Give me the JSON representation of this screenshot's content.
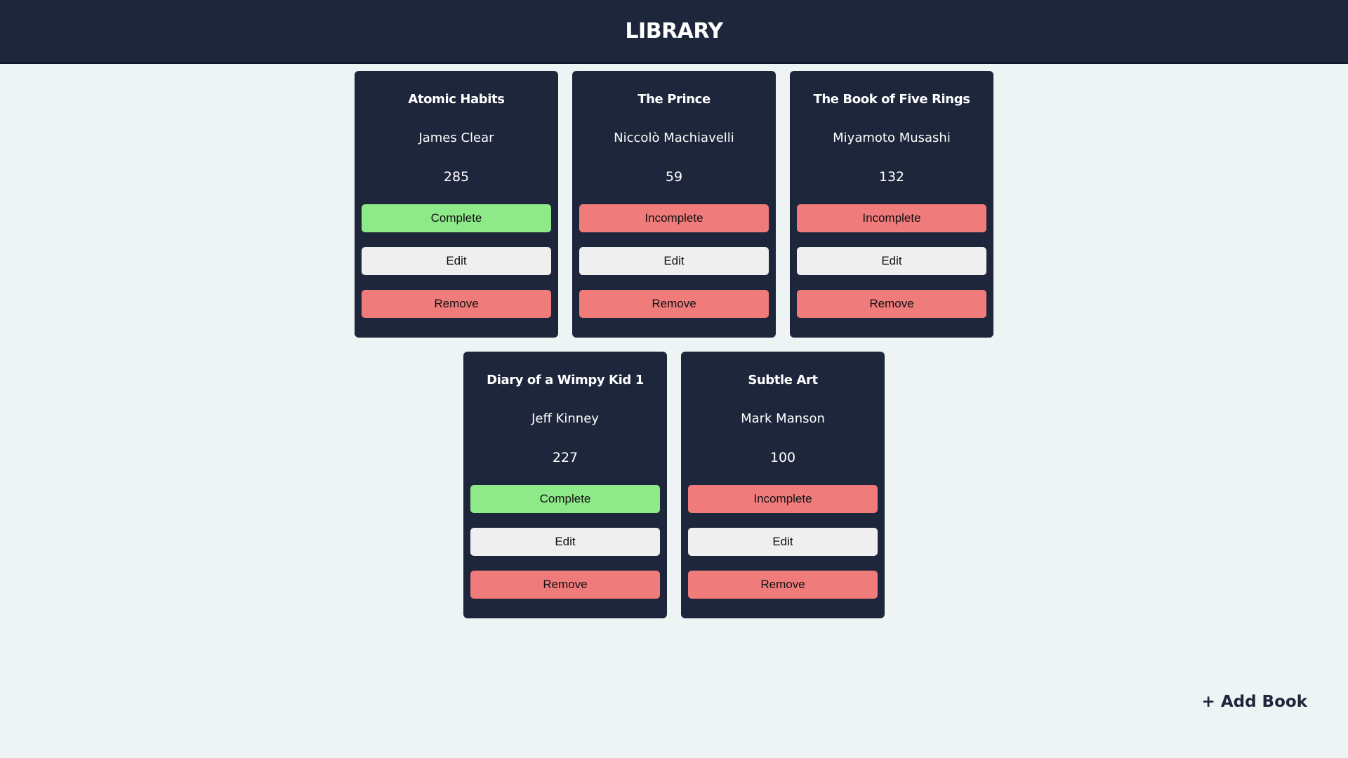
{
  "header": {
    "title": "LIBRARY"
  },
  "books": [
    {
      "title": "Atomic Habits",
      "author": "James Clear",
      "pages": "285",
      "status": "Complete",
      "edit_label": "Edit",
      "remove_label": "Remove"
    },
    {
      "title": "The Prince",
      "author": "Niccolò Machiavelli",
      "pages": "59",
      "status": "Incomplete",
      "edit_label": "Edit",
      "remove_label": "Remove"
    },
    {
      "title": "The Book of Five Rings",
      "author": "Miyamoto Musashi",
      "pages": "132",
      "status": "Incomplete",
      "edit_label": "Edit",
      "remove_label": "Remove"
    },
    {
      "title": "Diary of a Wimpy Kid 1",
      "author": "Jeff Kinney",
      "pages": "227",
      "status": "Complete",
      "edit_label": "Edit",
      "remove_label": "Remove"
    },
    {
      "title": "Subtle Art",
      "author": "Mark Manson",
      "pages": "100",
      "status": "Incomplete",
      "edit_label": "Edit",
      "remove_label": "Remove"
    }
  ],
  "add_book_label": "+ Add Book",
  "colors": {
    "header_bg": "#1e263b",
    "card_bg": "#1e263b",
    "page_bg": "#eef3f3",
    "complete": "#8eea89",
    "incomplete": "#ef7b7b",
    "remove": "#ef7b7b",
    "edit": "#efefef"
  }
}
